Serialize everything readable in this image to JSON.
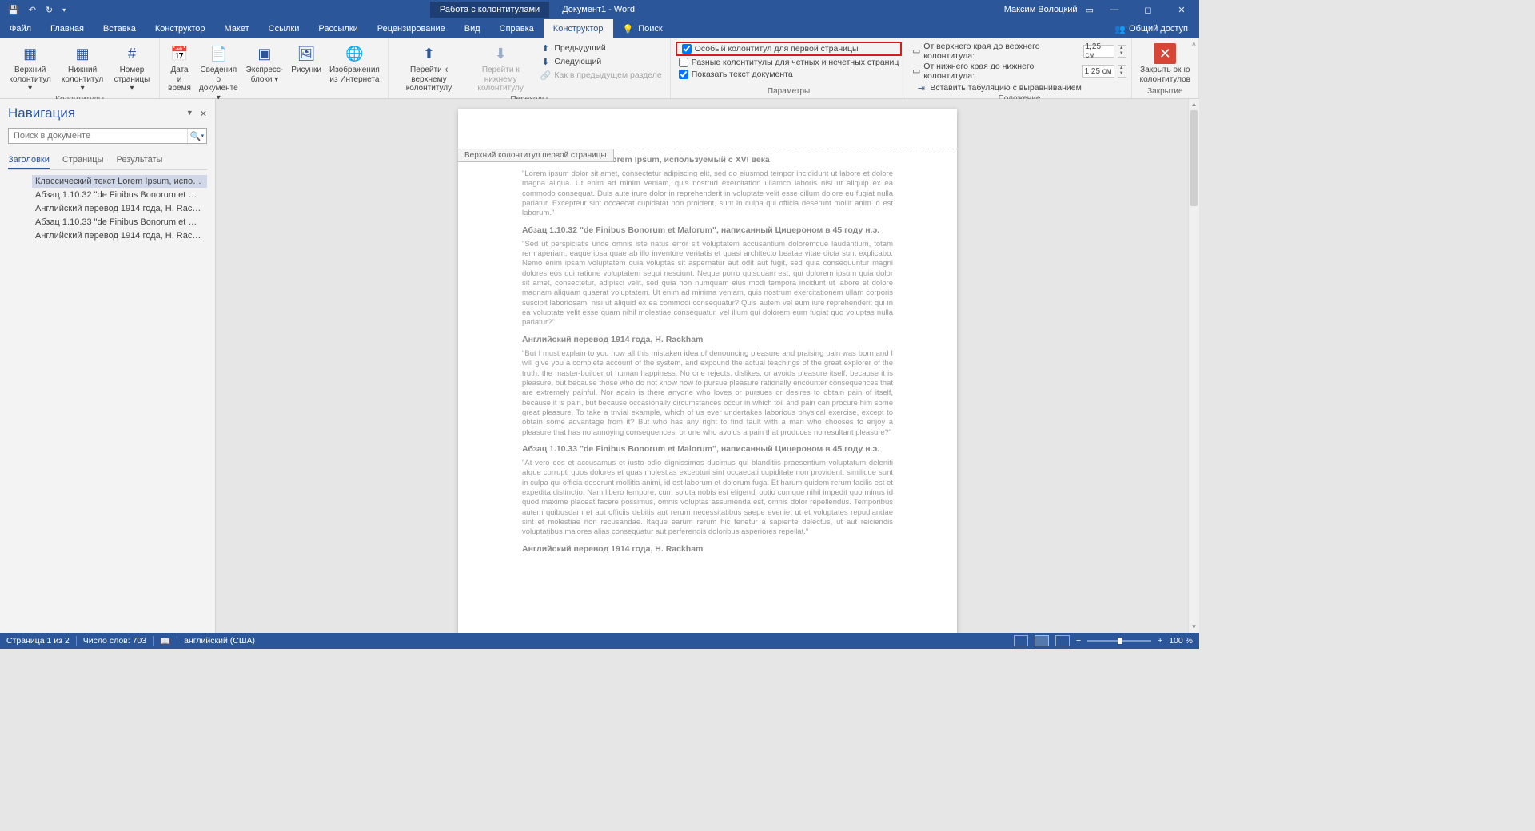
{
  "titlebar": {
    "context_tab": "Работа с колонтитулами",
    "doc_name": "Документ1 - Word",
    "user": "Максим Волоцкий"
  },
  "menu": {
    "file": "Файл",
    "home": "Главная",
    "insert": "Вставка",
    "constructor": "Конструктор",
    "layout": "Макет",
    "references": "Ссылки",
    "mailings": "Рассылки",
    "review": "Рецензирование",
    "view": "Вид",
    "help": "Справка",
    "design_active": "Конструктор",
    "search_icon_label": "Поиск",
    "share": "Общий доступ"
  },
  "ribbon": {
    "g1": {
      "header": "Верхний\nколонтитул ▾",
      "footer": "Нижний\nколонтитул ▾",
      "pagenum": "Номер\nстраницы ▾",
      "label": "Колонтитулы"
    },
    "g2": {
      "datetime": "Дата и\nвремя",
      "docinfo": "Сведения о\nдокументе ▾",
      "quickparts": "Экспресс-\nблоки ▾",
      "pictures": "Рисунки",
      "onlinepics": "Изображения\nиз Интернета",
      "label": "Вставка"
    },
    "g3": {
      "gotoheader": "Перейти к верхнему\nколонтитулу",
      "gotofooter": "Перейти к нижнему\nколонтитулу",
      "prev": "Предыдущий",
      "next": "Следующий",
      "sameasprev": "Как в предыдущем разделе",
      "label": "Переходы"
    },
    "g4": {
      "firstpage": "Особый колонтитул для первой страницы",
      "oddeven": "Разные колонтитулы для четных и нечетных страниц",
      "showdoc": "Показать текст документа",
      "label": "Параметры"
    },
    "g5": {
      "fromtop": "От верхнего края до верхнего колонтитула:",
      "frombottom": "От нижнего края до нижнего колонтитула:",
      "aligntab": "Вставить табуляцию с выравниванием",
      "val1": "1,25 см",
      "val2": "1,25 см",
      "label": "Положение"
    },
    "g6": {
      "close": "Закрыть окно\nколонтитулов",
      "label": "Закрытие"
    }
  },
  "nav": {
    "title": "Навигация",
    "search_placeholder": "Поиск в документе",
    "tabs": {
      "headings": "Заголовки",
      "pages": "Страницы",
      "results": "Результаты"
    },
    "items": [
      "Классический текст Lorem Ipsum, использу…",
      "Абзац 1.10.32 \"de Finibus Bonorum et Malor…",
      "Английский перевод 1914 года, H. Rackham",
      "Абзац 1.10.33 \"de Finibus Bonorum et Malor…",
      "Английский перевод 1914 года, H. Rackham"
    ]
  },
  "doc": {
    "hftag": "Верхний колонтитул первой страницы",
    "h1": "Классический текст Lorem Ipsum, используемый с XVI века",
    "p1": "\"Lorem ipsum dolor sit amet, consectetur adipiscing elit, sed do eiusmod tempor incididunt ut labore et dolore magna aliqua. Ut enim ad minim veniam, quis nostrud exercitation ullamco laboris nisi ut aliquip ex ea commodo consequat. Duis aute irure dolor in reprehenderit in voluptate velit esse cillum dolore eu fugiat nulla pariatur. Excepteur sint occaecat cupidatat non proident, sunt in culpa qui officia deserunt mollit anim id est laborum.\"",
    "h2": "Абзац 1.10.32 \"de Finibus Bonorum et Malorum\", написанный Цицероном в 45 году н.э.",
    "p2": "\"Sed ut perspiciatis unde omnis iste natus error sit voluptatem accusantium doloremque laudantium, totam rem aperiam, eaque ipsa quae ab illo inventore veritatis et quasi architecto beatae vitae dicta sunt explicabo. Nemo enim ipsam voluptatem quia voluptas sit aspernatur aut odit aut fugit, sed quia consequuntur magni dolores eos qui ratione voluptatem sequi nesciunt. Neque porro quisquam est, qui dolorem ipsum quia dolor sit amet, consectetur, adipisci velit, sed quia non numquam eius modi tempora incidunt ut labore et dolore magnam aliquam quaerat voluptatem. Ut enim ad minima veniam, quis nostrum exercitationem ullam corporis suscipit laboriosam, nisi ut aliquid ex ea commodi consequatur? Quis autem vel eum iure reprehenderit qui in ea voluptate velit esse quam nihil molestiae consequatur, vel illum qui dolorem eum fugiat quo voluptas nulla pariatur?\"",
    "h3": "Английский перевод 1914 года, H. Rackham",
    "p3": "\"But I must explain to you how all this mistaken idea of denouncing pleasure and praising pain was born and I will give you a complete account of the system, and expound the actual teachings of the great explorer of the truth, the master-builder of human happiness. No one rejects, dislikes, or avoids pleasure itself, because it is pleasure, but because those who do not know how to pursue pleasure rationally encounter consequences that are extremely painful. Nor again is there anyone who loves or pursues or desires to obtain pain of itself, because it is pain, but because occasionally circumstances occur in which toil and pain can procure him some great pleasure. To take a trivial example, which of us ever undertakes laborious physical exercise, except to obtain some advantage from it? But who has any right to find fault with a man who chooses to enjoy a pleasure that has no annoying consequences, or one who avoids a pain that produces no resultant pleasure?\"",
    "h4": "Абзац 1.10.33 \"de Finibus Bonorum et Malorum\", написанный Цицероном в 45 году н.э.",
    "p4": "\"At vero eos et accusamus et iusto odio dignissimos ducimus qui blanditiis praesentium voluptatum deleniti atque corrupti quos dolores et quas molestias excepturi sint occaecati cupiditate non provident, similique sunt in culpa qui officia deserunt mollitia animi, id est laborum et dolorum fuga. Et harum quidem rerum facilis est et expedita distinctio. Nam libero tempore, cum soluta nobis est eligendi optio cumque nihil impedit quo minus id quod maxime placeat facere possimus, omnis voluptas assumenda est, omnis dolor repellendus. Temporibus autem quibusdam et aut officiis debitis aut rerum necessitatibus saepe eveniet ut et voluptates repudiandae sint et molestiae non recusandae. Itaque earum rerum hic tenetur a sapiente delectus, ut aut reiciendis voluptatibus maiores alias consequatur aut perferendis doloribus asperiores repellat.\"",
    "h5": "Английский перевод 1914 года, H. Rackham"
  },
  "status": {
    "page": "Страница 1 из 2",
    "words": "Число слов: 703",
    "lang": "английский (США)",
    "zoom": "100 %",
    "minus": "−",
    "plus": "+"
  }
}
